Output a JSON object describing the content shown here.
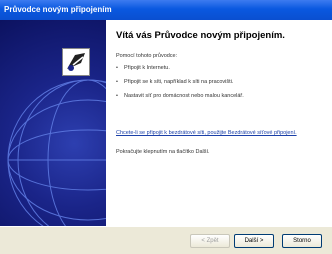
{
  "window": {
    "title": "Průvodce novým připojením"
  },
  "icons": {
    "wizard": "network-connection-wizard-icon"
  },
  "main": {
    "heading": "Vítá vás Průvodce novým připojením.",
    "intro": "Pomocí tohoto průvodce:",
    "tasks": [
      {
        "label": "Připojit k Internetu."
      },
      {
        "label": "Připojit se k síti, například k síti na pracovišti."
      },
      {
        "label": "Nastavit síť pro domácnost nebo malou kancelář."
      }
    ],
    "link": "Chcete-li se připojit k bezdrátové síti, použijte Bezdrátové síťové připojení.",
    "footer": "Pokračujte klepnutím na tlačítko Další."
  },
  "buttons": {
    "back": "< Zpět",
    "next": "Další >",
    "cancel": "Storno"
  }
}
